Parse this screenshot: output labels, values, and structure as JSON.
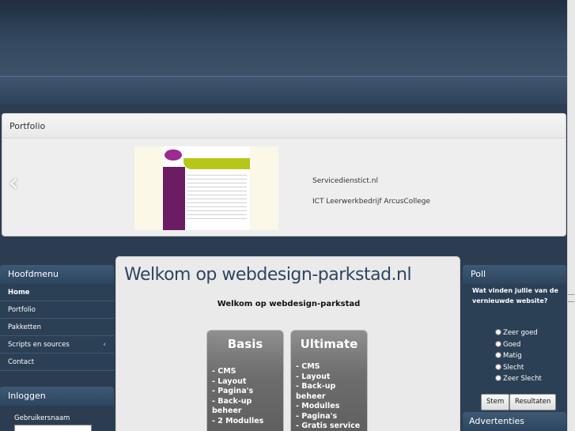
{
  "portfolio": {
    "title": "Portfolio",
    "prev_arrow": "‹",
    "next_arrow": "›",
    "slide_line1": "Servicedienstict.nl",
    "slide_line2": "ICT Leerwerkbedrijf ArcusCollege"
  },
  "menu": {
    "title": "Hoofdmenu",
    "items": [
      {
        "label": "Home"
      },
      {
        "label": "Portfolio"
      },
      {
        "label": "Pakketten"
      },
      {
        "label": "Scripts en sources"
      },
      {
        "label": "Contact"
      }
    ],
    "chevron": "‹"
  },
  "login": {
    "title": "Inloggen",
    "username_label": "Gebruikersnaam"
  },
  "main": {
    "title": "Welkom op webdesign-parkstad.nl",
    "subtitle": "Welkom op webdesign-parkstad",
    "packages": [
      {
        "name": "Basis",
        "features": [
          "- CMS",
          "- Layout",
          "- Pagina's",
          "- Back-up beheer",
          "- 2 Modulles"
        ]
      },
      {
        "name": "Ultimate",
        "features": [
          "- CMS",
          "- Layout",
          "- Back-up beheer",
          "- Modulles",
          "- Pagina's",
          "- Gratis service"
        ]
      }
    ]
  },
  "poll": {
    "title": "Poll",
    "question": "Wat vinden jullie van de vernieuwde website?",
    "options": [
      "Zeer goed",
      "Goed",
      "Matig",
      "Slecht",
      "Zeer Slecht"
    ],
    "vote_label": "Stem",
    "results_label": "Resultaten"
  },
  "ads": {
    "title": "Advertenties"
  }
}
